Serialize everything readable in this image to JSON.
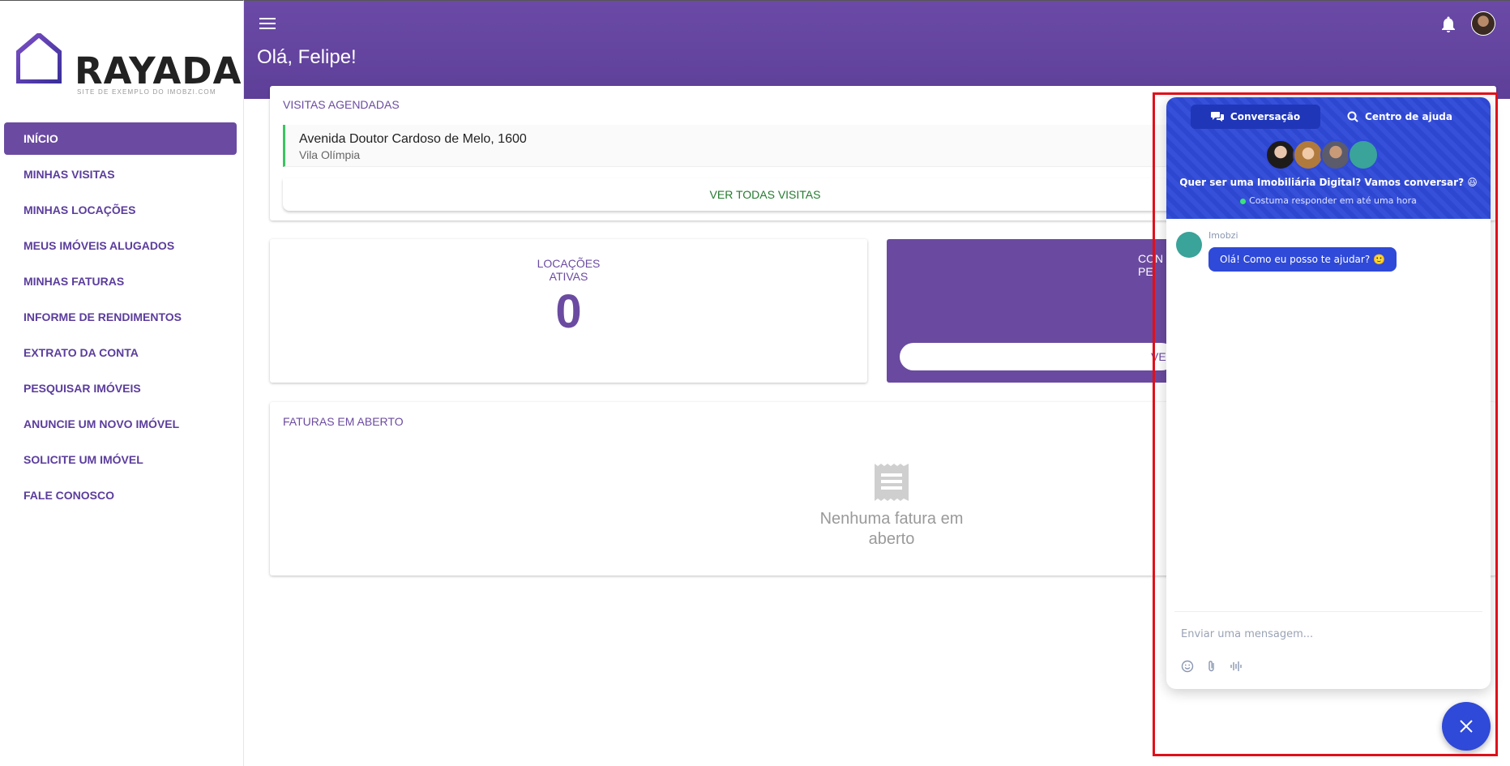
{
  "brand": {
    "name": "RAYADA",
    "tagline": "SITE DE EXEMPLO DO IMOBZI.COM",
    "accent": "#6b4ba1"
  },
  "sidebar": {
    "items": [
      {
        "label": "INÍCIO",
        "active": true
      },
      {
        "label": "MINHAS VISITAS"
      },
      {
        "label": "MINHAS LOCAÇÕES"
      },
      {
        "label": "MEUS IMÓVEIS ALUGADOS"
      },
      {
        "label": "MINHAS FATURAS"
      },
      {
        "label": "INFORME DE RENDIMENTOS"
      },
      {
        "label": "EXTRATO DA CONTA"
      },
      {
        "label": "PESQUISAR IMÓVEIS"
      },
      {
        "label": "ANUNCIE UM NOVO IMÓVEL"
      },
      {
        "label": "SOLICITE UM IMÓVEL"
      },
      {
        "label": "FALE CONOSCO"
      }
    ]
  },
  "header": {
    "greeting": "Olá, Felipe!",
    "menu_icon": "hamburger-icon",
    "bell_icon": "bell-icon"
  },
  "visits": {
    "title": "VISITAS AGENDADAS",
    "items": [
      {
        "address": "Avenida Doutor Cardoso de Melo, 1600",
        "area": "Vila Olímpia"
      }
    ],
    "view_all": "VER TODAS VISITAS"
  },
  "stats": {
    "locacoes_label_line1": "LOCAÇÕES",
    "locacoes_label_line2": "ATIVAS",
    "locacoes_value": "0",
    "purple_title_line1": "CON",
    "purple_title_line2": "PE",
    "purple_button": "VE"
  },
  "invoices": {
    "title": "FATURAS EM ABERTO",
    "empty_line1": "Nenhuma fatura em",
    "empty_line2": "aberto"
  },
  "chat": {
    "tab_conversation": "Conversação",
    "tab_help": "Centro de ajuda",
    "question": "Quer ser uma Imobiliária Digital? Vamos conversar? 😃",
    "status": "Costuma responder em até uma hora",
    "bot_name": "Imobzi",
    "bot_message": "Olá! Como eu posso te ajudar? 🙂",
    "input_placeholder": "Enviar uma mensagem...",
    "color": "#2f49d8"
  }
}
